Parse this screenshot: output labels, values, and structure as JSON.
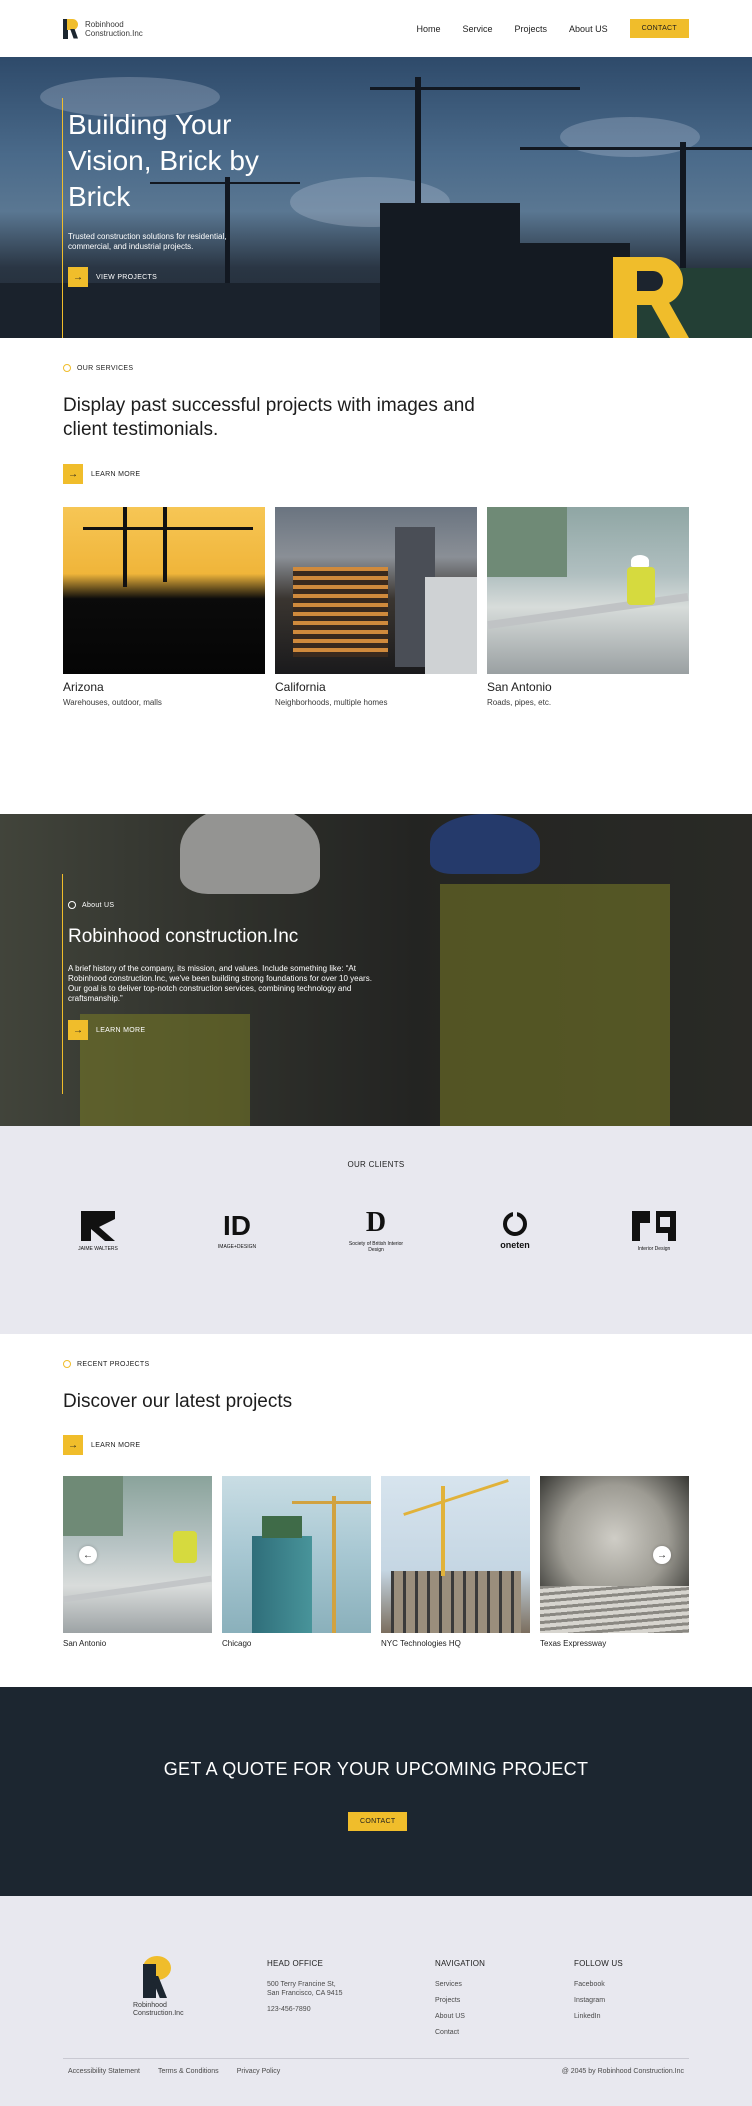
{
  "header": {
    "brand_line1": "Robinhood",
    "brand_line2": "Construction.Inc",
    "nav": [
      "Home",
      "Service",
      "Projects",
      "About US"
    ],
    "contact_button": "CONTACT"
  },
  "hero": {
    "title": "Building Your Vision, Brick by Brick",
    "subtitle": "Trusted construction solutions for residential, commercial, and industrial projects.",
    "cta": "VIEW PROJECTS"
  },
  "services": {
    "eyebrow": "OUR SERVICES",
    "title": "Display past successful projects with images and client testimonials.",
    "cta": "LEARN MORE",
    "cards": [
      {
        "name": "Arizona",
        "desc": "Warehouses, outdoor, malls"
      },
      {
        "name": "California",
        "desc": "Neighborhoods, multiple homes"
      },
      {
        "name": "San Antonio",
        "desc": "Roads, pipes, etc."
      }
    ]
  },
  "about": {
    "eyebrow": "About US",
    "title": "Robinhood construction.Inc",
    "body": "A brief history of the company, its mission, and values. Include something like: “At Robinhood construction.Inc, we've been building strong foundations for over 10 years. Our goal is to deliver top-notch construction services, combining technology and craftsmanship.”",
    "cta": "LEARN MORE"
  },
  "clients": {
    "label": "OUR CLIENTS",
    "logos": [
      {
        "glyph": "K",
        "caption": "JAIME WALTERS"
      },
      {
        "glyph": "ID",
        "caption": "IMAGE+DESIGN"
      },
      {
        "glyph": "D",
        "caption": "Society of British Interior Design"
      },
      {
        "glyph": "O",
        "caption": "oneten"
      },
      {
        "glyph": "ID",
        "caption": "Interior Design"
      }
    ]
  },
  "recent": {
    "eyebrow": "RECENT PROJECTS",
    "title": "Discover our latest projects",
    "cta": "LEARN MORE",
    "projects": [
      "San Antonio",
      "Chicago",
      "NYC Technologies HQ",
      "Texas Expressway"
    ]
  },
  "quote": {
    "title": "GET A QUOTE FOR YOUR UPCOMING PROJECT",
    "button": "CONTACT"
  },
  "footer": {
    "brand_line1": "Robinhood",
    "brand_line2": "Construction.Inc",
    "head_office": {
      "title": "HEAD OFFICE",
      "addr1": "500 Terry Francine St,",
      "addr2": "San Francisco, CA 9415",
      "phone": "123-456-7890"
    },
    "navigation": {
      "title": "NAVIGATION",
      "links": [
        "Services",
        "Projects",
        "About US",
        "Contact"
      ]
    },
    "follow": {
      "title": "FOLLOW US",
      "links": [
        "Facebook",
        "Instagram",
        "LinkedIn"
      ]
    },
    "legal": [
      "Accessibility Statement",
      "Terms & Conditions",
      "Privacy Policy"
    ],
    "copyright": "@ 2045 by Robinhood Construction.Inc"
  },
  "colors": {
    "accent": "#f0bd2b",
    "navy": "#1c2630",
    "light_bg": "#e8e8ef"
  },
  "icons": [
    "arrow-right-icon",
    "arrow-left-icon",
    "sun-icon"
  ]
}
